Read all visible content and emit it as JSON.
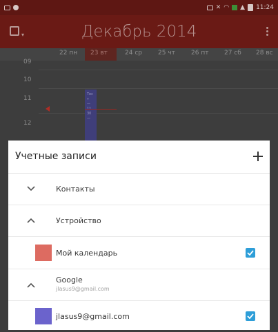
{
  "status_bar": {
    "time": "11:24",
    "icons": [
      "screen-icon",
      "photo-icon",
      "sim-icon",
      "mute-icon",
      "wifi-icon",
      "data-icon",
      "signal-icon",
      "battery-icon"
    ]
  },
  "calendar": {
    "month_title": "Декабрь 2014",
    "days": [
      "22 пн",
      "23 вт",
      "24 ср",
      "25 чт",
      "26 пт",
      "27 сб",
      "28 вс"
    ],
    "today_index": 1,
    "hours": [
      "09",
      "10",
      "11",
      "12"
    ],
    "event_text": [
      "Тес",
      "т",
      "—",
      "11",
      "30",
      "—"
    ],
    "colors": {
      "appbar": "#6a1a15",
      "event": "#3f3e7a",
      "now_line": "#9d2620"
    }
  },
  "sheet": {
    "title": "Учетные записи",
    "add_icon": "plus-icon",
    "sections": [
      {
        "label": "Контакты",
        "expanded": false
      },
      {
        "label": "Устройство",
        "expanded": true
      },
      {
        "label": "Мой календарь",
        "color": "#dd6b61",
        "checked": true
      },
      {
        "label": "Google",
        "sub": "jlasus9@gmail.com",
        "expanded": true
      },
      {
        "label": "jlasus9@gmail.com",
        "color": "#6b63cc",
        "checked": true
      }
    ],
    "accent": "#2e9ed8"
  }
}
